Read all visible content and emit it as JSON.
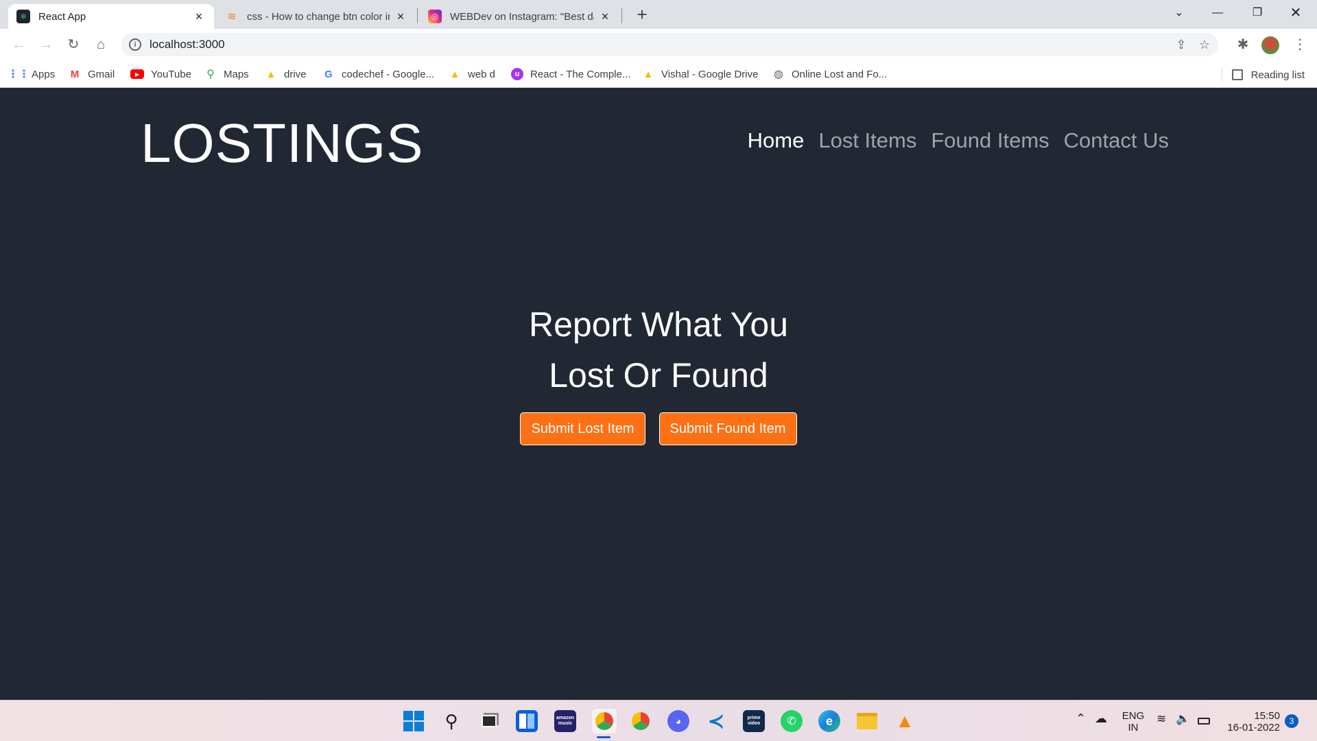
{
  "browser": {
    "tabs": [
      {
        "title": "React App",
        "icon": "react-icon",
        "active": true
      },
      {
        "title": "css - How to change btn color in",
        "icon": "stackoverflow-icon",
        "active": false
      },
      {
        "title": "WEBDev on Instagram: \"Best darl",
        "icon": "instagram-icon",
        "active": false
      }
    ],
    "new_tab": "+",
    "url": "localhost:3000",
    "bookmarks": [
      {
        "label": "Apps",
        "icon": "apps-grid-icon"
      },
      {
        "label": "Gmail",
        "icon": "gmail-icon"
      },
      {
        "label": "YouTube",
        "icon": "youtube-icon"
      },
      {
        "label": "Maps",
        "icon": "maps-icon"
      },
      {
        "label": "drive",
        "icon": "drive-icon"
      },
      {
        "label": "codechef - Google...",
        "icon": "google-icon"
      },
      {
        "label": "web d",
        "icon": "drive-icon"
      },
      {
        "label": "React - The Comple...",
        "icon": "udemy-icon"
      },
      {
        "label": "Vishal - Google Drive",
        "icon": "drive-icon"
      },
      {
        "label": "Online Lost and Fo...",
        "icon": "globe-icon"
      }
    ],
    "reading_list": "Reading list"
  },
  "site": {
    "brand": "LOSTINGS",
    "nav": [
      {
        "label": "Home",
        "active": true
      },
      {
        "label": "Lost Items",
        "active": false
      },
      {
        "label": "Found Items",
        "active": false
      },
      {
        "label": "Contact Us",
        "active": false
      }
    ],
    "hero_line1": "Report What You",
    "hero_line2": "Lost Or Found",
    "buttons": {
      "lost": "Submit Lost Item",
      "found": "Submit Found Item"
    },
    "colors": {
      "background": "#222833",
      "accent": "#fd7014"
    }
  },
  "taskbar": {
    "apps": [
      "windows-start-icon",
      "search-icon",
      "task-view-icon",
      "widgets-icon",
      "amazon-music-icon",
      "chrome-icon",
      "chrome-profile-icon",
      "discord-icon",
      "vscode-icon",
      "prime-video-icon",
      "whatsapp-icon",
      "edge-icon",
      "file-explorer-icon",
      "vlc-icon"
    ],
    "amazon_music_label": "amazon music",
    "prime_video_label": "prime video",
    "lang_top": "ENG",
    "lang_bottom": "IN",
    "time": "15:50",
    "date": "16-01-2022",
    "notifications": "3"
  }
}
